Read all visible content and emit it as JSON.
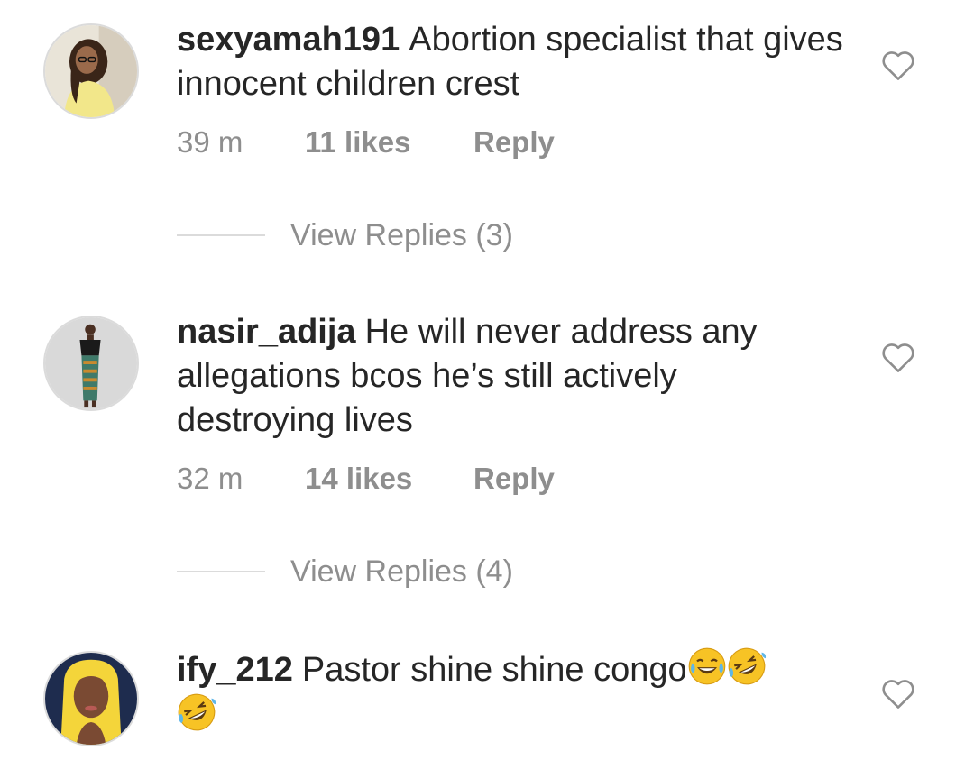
{
  "comments": [
    {
      "username": "sexyamah191",
      "text": "Abortion specialist that gives innocent children crest",
      "time": "39 m",
      "likes": "11 likes",
      "reply": "Reply",
      "avatar_icon": "user-avatar-photo",
      "view_replies": "View Replies (3)"
    },
    {
      "username": "nasir_adija",
      "text": "He will never address any allegations bcos he’s still actively destroying lives",
      "time": "32 m",
      "likes": "14 likes",
      "reply": "Reply",
      "avatar_icon": "user-avatar-photo",
      "view_replies": "View Replies (4)"
    },
    {
      "username": "ify_212",
      "text": "Pastor shine shine congo",
      "emojis": [
        "😂",
        "🤣",
        "🤣"
      ],
      "avatar_icon": "user-avatar-photo"
    }
  ],
  "icons": {
    "like": "heart-outline-icon"
  },
  "colors": {
    "text": "#262626",
    "secondary": "#8e8e8e",
    "divider": "#dbdbdb",
    "emoji": "#f7c325"
  }
}
